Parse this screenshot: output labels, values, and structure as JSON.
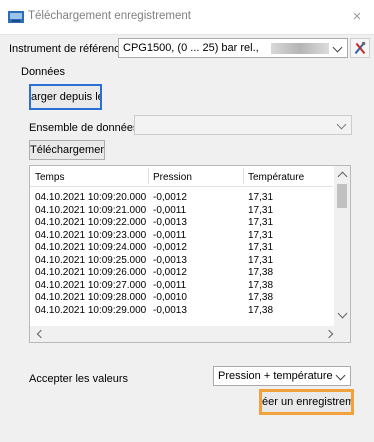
{
  "window": {
    "title": "Téléchargement enregistrement",
    "close_glyph": "×"
  },
  "instrument": {
    "label": "Instrument de référence:",
    "value": "CPG1500, (0 ... 25) bar rel.,"
  },
  "donnees": {
    "label": "Données",
    "load_button": "arger depuis le F",
    "dataset_label": "Ensemble de données",
    "dataset_value": "",
    "download_button": "Téléchargement"
  },
  "table": {
    "columns": [
      "Temps",
      "Pression",
      "Température"
    ],
    "rows": [
      [
        "04.10.2021 10:09:20.000",
        "-0,0012",
        "17,31"
      ],
      [
        "04.10.2021 10:09:21.000",
        "-0,0011",
        "17,31"
      ],
      [
        "04.10.2021 10:09:22.000",
        "-0,0013",
        "17,31"
      ],
      [
        "04.10.2021 10:09:23.000",
        "-0,0011",
        "17,31"
      ],
      [
        "04.10.2021 10:09:24.000",
        "-0,0012",
        "17,31"
      ],
      [
        "04.10.2021 10:09:25.000",
        "-0,0013",
        "17,31"
      ],
      [
        "04.10.2021 10:09:26.000",
        "-0,0012",
        "17,38"
      ],
      [
        "04.10.2021 10:09:27.000",
        "-0,0011",
        "17,38"
      ],
      [
        "04.10.2021 10:09:28.000",
        "-0,0010",
        "17,38"
      ],
      [
        "04.10.2021 10:09:29.000",
        "-0,0013",
        "17,38"
      ]
    ]
  },
  "accept": {
    "label": "Accepter les valeurs",
    "value": "Pression + température"
  },
  "create_button": "éer un enregistreme",
  "colors": {
    "highlight": "#f2a23b",
    "focus": "#2a6fd6"
  }
}
